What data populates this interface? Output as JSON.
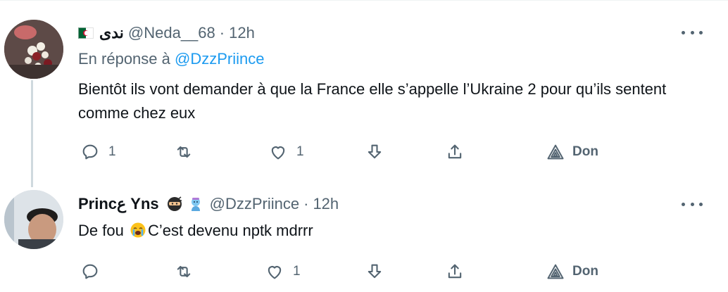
{
  "colors": {
    "link": "#1d9bf0",
    "muted": "#536471",
    "text": "#0f1419",
    "thread_line": "#cfd9de"
  },
  "tweets": [
    {
      "flag_icon": "algeria-flag-icon",
      "display_name": "ندى",
      "handle": "@Neda__68",
      "separator": "·",
      "time": "12h",
      "reply_prefix": "En réponse à",
      "reply_handle": "@DzzPriince",
      "text": "Bientôt ils vont demander à que la France elle s’appelle l’Ukraine 2 pour qu’ils sentent comme chez eux",
      "actions": {
        "reply_count": "1",
        "retweet_count": "",
        "like_count": "1",
        "donate_label": "Don"
      }
    },
    {
      "display_name": "Princع Yns",
      "name_emojis": [
        "ninja-emoji",
        "genie-emoji"
      ],
      "handle": "@DzzPriince",
      "separator": "·",
      "time": "12h",
      "text_before": "De fou",
      "inline_emoji": "loudly-crying-face-emoji",
      "text_after": "C’est devenu nptk mdrrr",
      "actions": {
        "reply_count": "",
        "retweet_count": "",
        "like_count": "1",
        "donate_label": "Don"
      }
    }
  ]
}
